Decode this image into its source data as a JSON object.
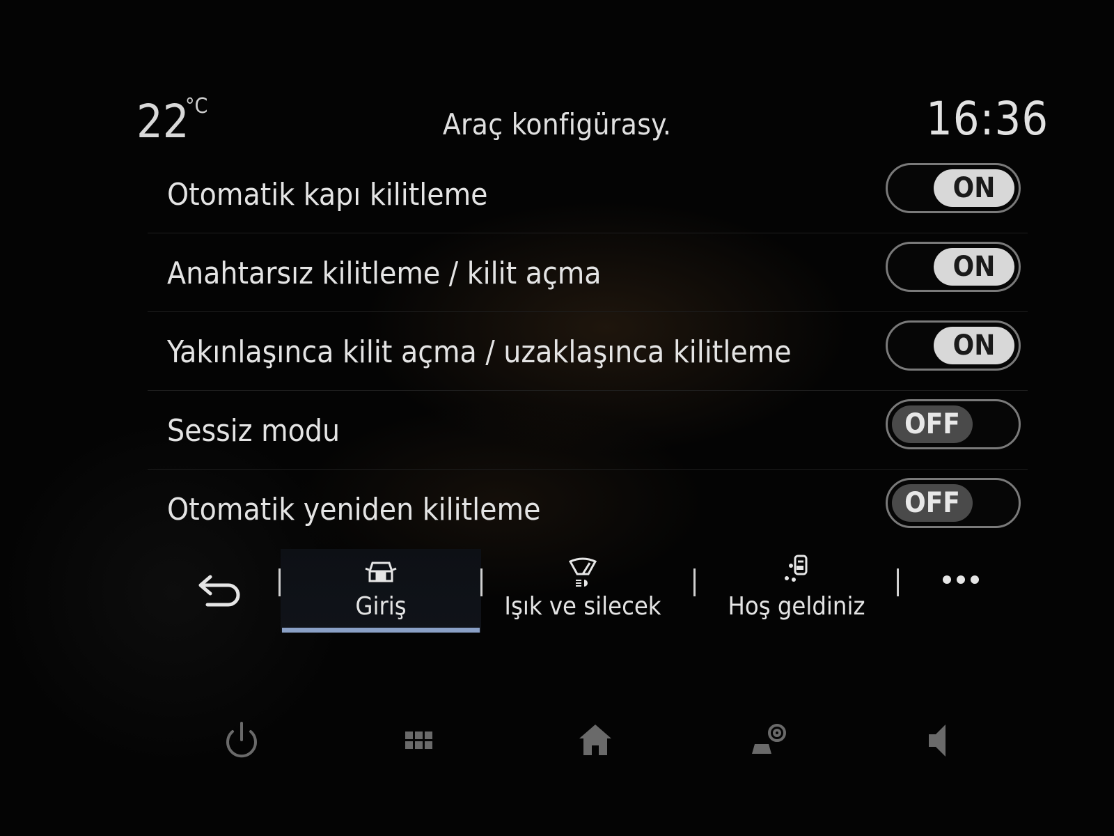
{
  "header": {
    "temperature": "22",
    "temperature_unit": "°C",
    "title": "Araç konfigürasy.",
    "time": "16:36"
  },
  "settings": [
    {
      "label": "Otomatik kapı kilitleme",
      "state": "ON"
    },
    {
      "label": "Anahtarsız kilitleme / kilit açma",
      "state": "ON"
    },
    {
      "label": "Yakınlaşınca kilit açma / uzaklaşınca kilitleme",
      "state": "ON"
    },
    {
      "label": "Sessiz modu",
      "state": "OFF"
    },
    {
      "label": "Otomatik yeniden kilitleme",
      "state": "OFF"
    }
  ],
  "tabs": [
    {
      "label": "Giriş",
      "icon": "car-lock-icon",
      "active": true
    },
    {
      "label": "Işık ve silecek",
      "icon": "wiper-light-icon",
      "active": false
    },
    {
      "label": "Hoş geldiniz",
      "icon": "welcome-person-icon",
      "active": false
    }
  ],
  "icons": {
    "back": "back-arrow-icon",
    "more": "more-dots-icon",
    "power": "power-icon",
    "apps": "apps-grid-icon",
    "home": "home-icon",
    "car_settings": "car-settings-icon",
    "volume": "volume-icon"
  },
  "colors": {
    "background": "#040404",
    "text": "#e4e4e4",
    "toggle_on_knob": "#d8d8d8",
    "toggle_off_knob": "#4a4a4a",
    "active_tab_underline": "#8aa0c6"
  }
}
